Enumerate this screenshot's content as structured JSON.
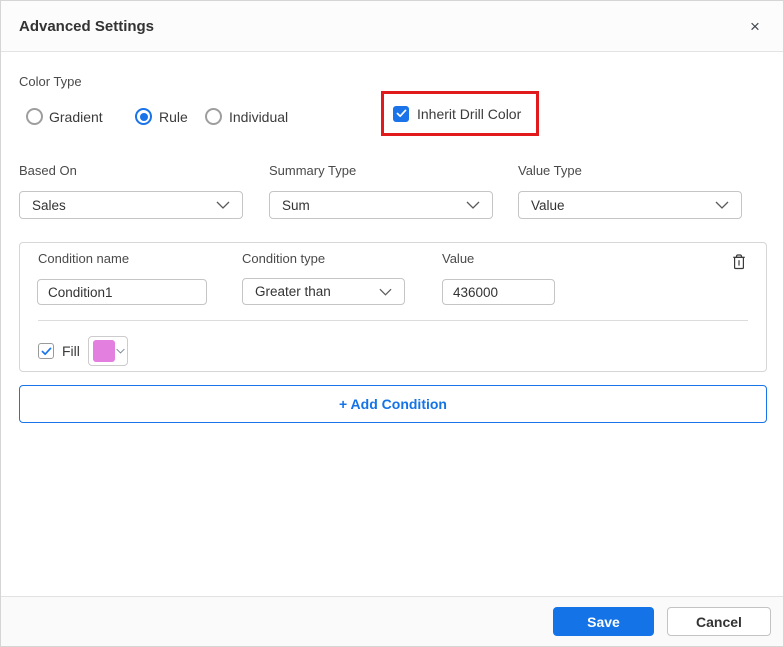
{
  "dialog": {
    "title": "Advanced Settings",
    "close_glyph": "×"
  },
  "color_type": {
    "label": "Color Type",
    "options": [
      {
        "label": "Gradient",
        "selected": false
      },
      {
        "label": "Rule",
        "selected": true
      },
      {
        "label": "Individual",
        "selected": false
      }
    ],
    "inherit_drill_color": {
      "label": "Inherit Drill Color",
      "checked": true,
      "annotation": "red-highlight-box",
      "annotation_color": "#e11b1b"
    }
  },
  "selectors": {
    "based_on": {
      "label": "Based On",
      "value": "Sales"
    },
    "summary_type": {
      "label": "Summary Type",
      "value": "Sum"
    },
    "value_type": {
      "label": "Value Type",
      "value": "Value"
    }
  },
  "condition": {
    "name": {
      "label": "Condition name",
      "value": "Condition1"
    },
    "type": {
      "label": "Condition type",
      "value": "Greater than"
    },
    "value": {
      "label": "Value",
      "value": "436000"
    },
    "fill": {
      "label": "Fill",
      "checked": true,
      "color": "#e27fdf"
    },
    "delete_icon": "trash-icon"
  },
  "add_condition": {
    "label": "+ Add Condition"
  },
  "footer": {
    "save_label": "Save",
    "cancel_label": "Cancel"
  },
  "colors": {
    "accent_blue": "#1a73e8",
    "save_button_blue": "#1473e6",
    "highlight_red": "#e11b1b",
    "fill_swatch": "#e27fdf"
  }
}
